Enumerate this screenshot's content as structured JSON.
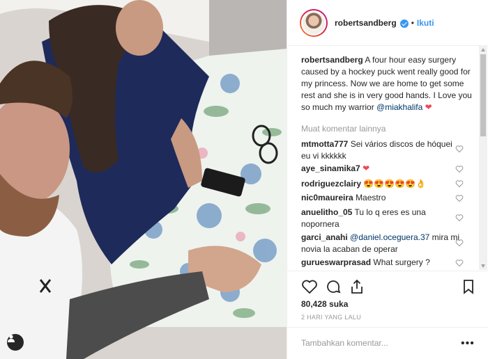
{
  "post": {
    "username": "robertsandberg",
    "verified_icon": "verified-badge-icon",
    "separator": "•",
    "follow_label": "Ikuti",
    "caption": {
      "username": "robertsandberg",
      "text": "A four hour easy surgery caused by a hockey puck went really good for my princess. Now we are home to get some rest and she is in very good hands. I Love you so much my warrior",
      "mention": "@miakhalifa",
      "emoji": "❤"
    },
    "load_more_label": "Muat komentar lainnya",
    "comments": [
      {
        "user": "mtmotta777",
        "text": "Sei vários discos de hóquei eu vi kkkkkk"
      },
      {
        "user": "aye_sinamika7",
        "text": "❤"
      },
      {
        "user": "rodriguezclairy",
        "text": "😍😍😍😍😍👌"
      },
      {
        "user": "nic0maureira",
        "text": "Maestro"
      },
      {
        "user": "anuelitho_05",
        "text": "Tu lo q eres es una nopornera"
      },
      {
        "user": "garci_anahi",
        "mention": "@daniel.oceguera.37",
        "text": "mira mi novia la acaban de operar"
      },
      {
        "user": "gurueswarprasad",
        "text": "What surgery ?"
      }
    ],
    "likes_label": "80,428 suka",
    "date_label": "2 HARI YANG LALU",
    "comment_placeholder": "Tambahkan komentar...",
    "more_label": "•••"
  },
  "colors": {
    "accent": "#3897f0",
    "heart": "#ed4956",
    "muted": "#999999",
    "mention": "#003569"
  }
}
